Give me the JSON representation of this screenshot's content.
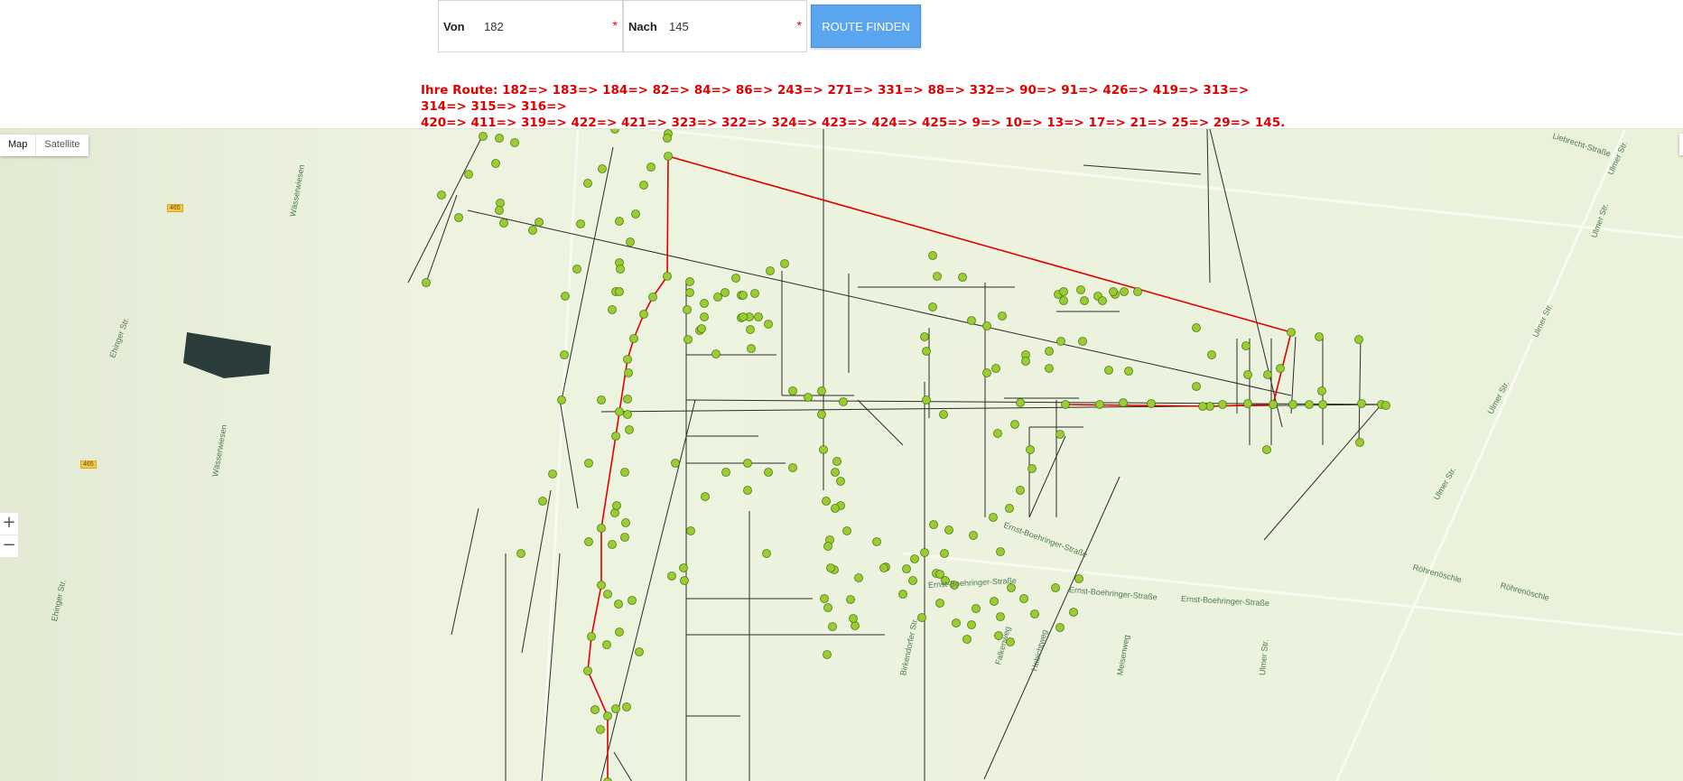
{
  "form": {
    "from_label": "Von",
    "from_value": "182",
    "to_label": "Nach",
    "to_value": "145",
    "required_mark": "*",
    "submit_label": "ROUTE FINDEN"
  },
  "route": {
    "prefix": "Ihre Route:",
    "line1": "182=> 183=> 184=> 82=> 84=> 86=> 243=> 271=> 331=> 88=> 332=> 90=> 91=> 426=> 419=> 313=> 314=> 315=> 316=>",
    "line2": "420=> 411=> 319=> 422=> 421=> 323=> 322=> 324=> 423=> 424=> 425=> 9=> 10=> 13=> 17=> 21=> 25=> 29=> 145."
  },
  "map": {
    "type_options": [
      "Map",
      "Satellite"
    ],
    "selected_type": "Map",
    "zoom_in": "+",
    "zoom_out": "−",
    "shield_1": "465",
    "shield_2": "465",
    "streets": {
      "s1": "Wässerwiesen",
      "s2": "Ehinger Str.",
      "s3": "Wässerwiesen",
      "s4": "Ehinger Str.",
      "s5": "Ulmer Str.",
      "s6": "Ulmer Str.",
      "s7": "Ulmer Str.",
      "s8": "Ulmer Str.",
      "s9": "Ulmer Str.",
      "s10": "Röhrenöschle",
      "s11": "Röhrenöschle",
      "s12": "Ernst-Boehringer-Straße",
      "s13": "Ernst-Boehringer-Straße",
      "s14": "Ernst-Boehringer-Straße",
      "s15": "Birkendorfer Str.",
      "s16": "Habichtweg",
      "s17": "Falkenweg",
      "s18": "Meisenweg",
      "s19": "Ernst-Boehringer-Straße",
      "s20": "Ulmer Str.",
      "s21": "Liebrecht-Straße"
    },
    "colors": {
      "route": "#e00000",
      "node_fill": "#9acd32",
      "node_stroke": "#4f7a10",
      "edge": "#2b2b2b",
      "background": "#edf3df"
    }
  }
}
